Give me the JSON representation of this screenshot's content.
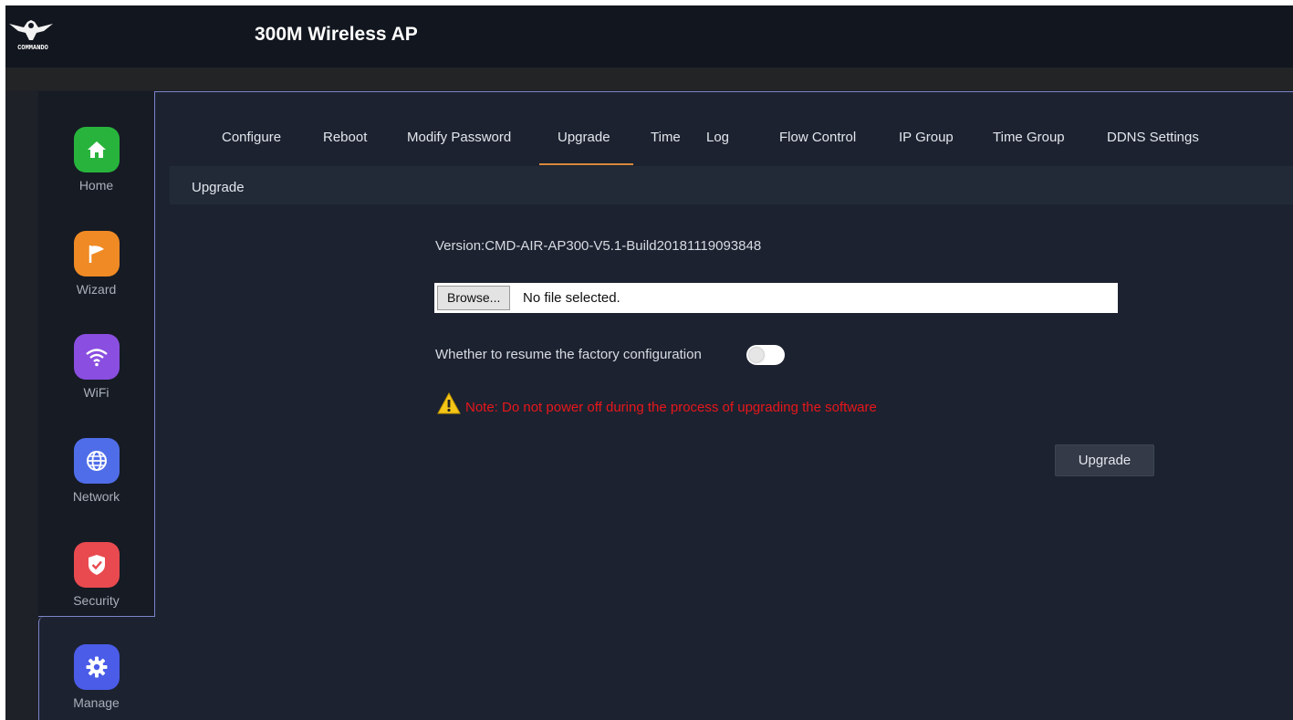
{
  "app": {
    "title": "300M Wireless AP",
    "logo_text": "COMMANDO"
  },
  "sidebar": {
    "items": [
      {
        "label": "Home",
        "icon": "home-icon",
        "color": "#28b43c"
      },
      {
        "label": "Wizard",
        "icon": "flag-icon",
        "color": "#f08a24"
      },
      {
        "label": "WiFi",
        "icon": "wifi-icon",
        "color": "#8a4ee0"
      },
      {
        "label": "Network",
        "icon": "globe-icon",
        "color": "#4f6de8"
      },
      {
        "label": "Security",
        "icon": "shield-icon",
        "color": "#e84a4f"
      },
      {
        "label": "Manage",
        "icon": "gear-icon",
        "color": "#4a5ce8"
      }
    ],
    "active": "Manage"
  },
  "tabs": [
    {
      "label": "Configure"
    },
    {
      "label": "Reboot"
    },
    {
      "label": "Modify Password"
    },
    {
      "label": "Upgrade"
    },
    {
      "label": "Time"
    },
    {
      "label": "Log"
    },
    {
      "label": "Flow Control"
    },
    {
      "label": "IP Group"
    },
    {
      "label": "Time Group"
    },
    {
      "label": "DDNS Settings"
    }
  ],
  "active_tab": "Upgrade",
  "section": {
    "title": "Upgrade"
  },
  "upgrade": {
    "version": "Version:CMD-AIR-AP300-V5.1-Build20181119093848",
    "browse_label": "Browse...",
    "file_status": "No file selected.",
    "resume_label": "Whether to resume the factory configuration",
    "resume_enabled": false,
    "note": "Note: Do not power off during the process of upgrading the software",
    "submit_label": "Upgrade"
  },
  "colors": {
    "accent_underline": "#d98a3c",
    "note": "#e8171b",
    "panel_border": "#7b84c9"
  }
}
